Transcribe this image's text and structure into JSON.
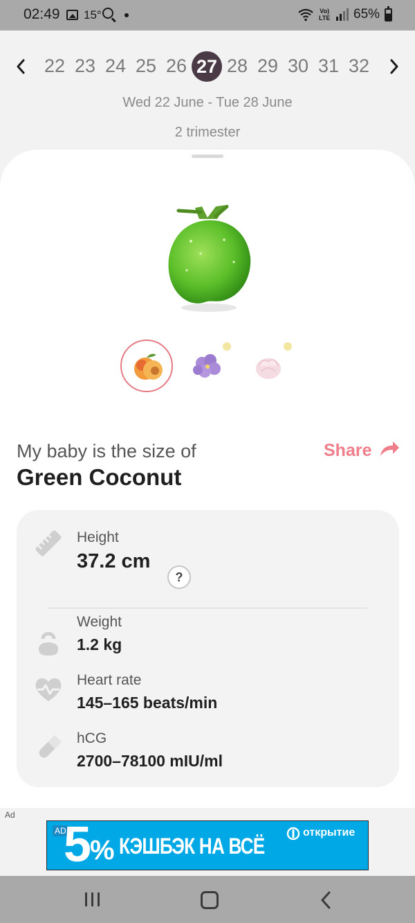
{
  "status_bar": {
    "time": "02:49",
    "temperature": "15°",
    "volte_top": "Vo)",
    "volte_bottom": "LTE",
    "battery": "65%"
  },
  "week_nav": {
    "weeks": [
      "22",
      "23",
      "24",
      "25",
      "26",
      "27",
      "28",
      "29",
      "30",
      "31",
      "32"
    ],
    "active_week": "27"
  },
  "date_range": "Wed 22 June - Tue 28 June",
  "trimester": "2 trimester",
  "baby_size": {
    "label": "My baby is the size of",
    "fruit": "Green Coconut",
    "share_label": "Share",
    "thumbnails": [
      "peach",
      "violet-flower",
      "marshmallow"
    ]
  },
  "stats": {
    "height": {
      "label": "Height",
      "value": "37.2 cm",
      "help": "?"
    },
    "weight": {
      "label": "Weight",
      "value": "1.2 kg"
    },
    "heart_rate": {
      "label": "Heart rate",
      "value": "145–165 beats/min"
    },
    "hcg": {
      "label": "hCG",
      "value": "2700–78100 mIU/ml"
    }
  },
  "ad": {
    "label": "Ad",
    "badge": "AD",
    "percent": "5",
    "percent_sign": "%",
    "headline": "КЭШБЭК НА ВСЁ",
    "brand": "открытие"
  },
  "colors": {
    "accent": "#ef7e8a",
    "active_week": "#4a3a46",
    "ad_background": "#00a8e6"
  }
}
